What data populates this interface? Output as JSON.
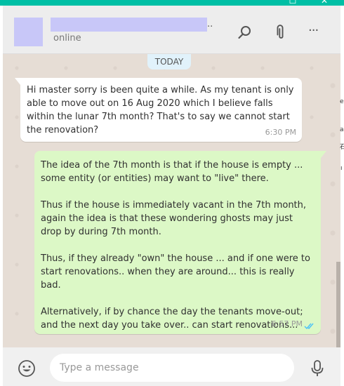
{
  "window": {
    "maximize_icon": "maximize-icon",
    "close_icon": "close-icon",
    "maximize_glyph": "☐",
    "close_glyph": "✕",
    "titlebar_color": "#00bfa5"
  },
  "header": {
    "name_suffix": "..",
    "status": "online",
    "icons": [
      "search-icon",
      "paperclip-icon",
      "more-vertical-icon"
    ],
    "menu_glyph": "···"
  },
  "chat": {
    "date_label": "TODAY",
    "messages": [
      {
        "direction": "incoming",
        "text": "Hi master sorry is been quite a while. As my tenant is only able to move out on 16 Aug 2020 which I believe falls within the lunar 7th month? That's to say we cannot start the renovation?",
        "time": "6:30 PM"
      },
      {
        "direction": "outgoing",
        "paragraphs": [
          "The idea of the 7th month is that if the house is empty ... some entity (or entities) may want to \"live\" there.",
          "Thus if the house is immediately vacant in the 7th month, again the idea is that these wondering ghosts may just drop by during 7th month.",
          "Thus, if they already \"own\" the house ... and if one were to start renovations.. when they are around... this is really bad.",
          "Alternatively, if by chance the day the tenants move-out; and the next day you take over.. can start renovations..."
        ],
        "time": "6:57 PM",
        "status_icon": "double-check-icon"
      }
    ]
  },
  "composer": {
    "placeholder": "Type a message",
    "emoji_icon": "emoji-icon",
    "mic_icon": "microphone-icon"
  },
  "side": {
    "fragments": [
      "e",
      "a",
      "⽯",
      "ı"
    ]
  },
  "colors": {
    "chat_bg": "#e6ddd5",
    "incoming_bubble": "#ffffff",
    "outgoing_bubble": "#dcf8c6",
    "header_bg": "#ededed",
    "read_tick": "#4fc3f7"
  }
}
